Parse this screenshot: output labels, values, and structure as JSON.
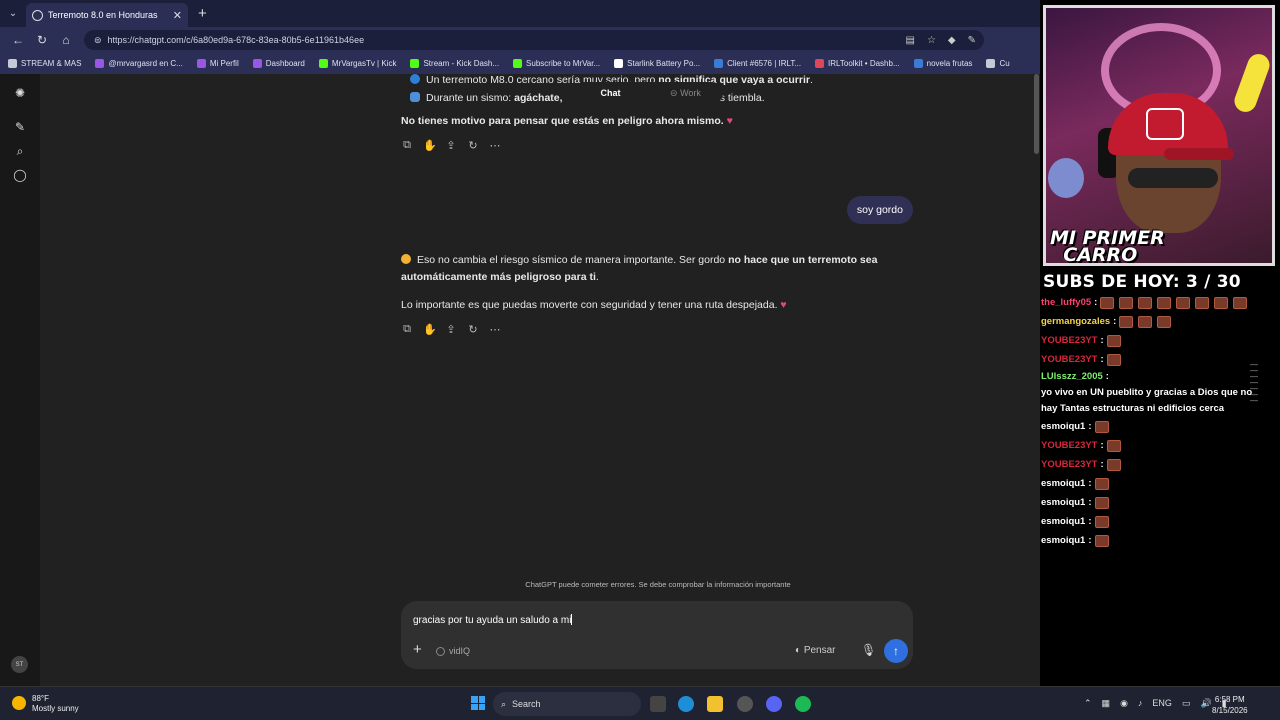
{
  "browser": {
    "tab_title": "Terremoto 8.0 en Honduras",
    "url": "https://chatgpt.com/c/6a80ed9a-678c-83ea-80b5-6e11961b46ee",
    "bookmarks": [
      {
        "label": "STREAM & MAS",
        "color": "#c7c9d6"
      },
      {
        "label": "@mrvargasrd en C...",
        "color": "#9a57e6"
      },
      {
        "label": "Mi Perfil",
        "color": "#9a57e6"
      },
      {
        "label": "Dashboard",
        "color": "#9a57e6"
      },
      {
        "label": "MrVargasTv | Kick",
        "color": "#53fc18"
      },
      {
        "label": "Stream - Kick Dash...",
        "color": "#53fc18"
      },
      {
        "label": "Subscribe to MrVar...",
        "color": "#53fc18"
      },
      {
        "label": "Starlink Battery Po...",
        "color": "#ffffff"
      },
      {
        "label": "Client #6576 | IRLT...",
        "color": "#3a7bd5"
      },
      {
        "label": "IRLToolkit • Dashb...",
        "color": "#e0455a"
      },
      {
        "label": "novela frutas",
        "color": "#3a7bd5"
      },
      {
        "label": "Cu",
        "color": "#c7c9d6"
      }
    ]
  },
  "chat": {
    "toggle": {
      "chat": "Chat",
      "work": "Work"
    },
    "bullets": [
      {
        "pre": "Un terremoto M8.0 cercano sería muy serio, pero ",
        "bold": "no significa que vaya a ocurrir",
        "post": "."
      },
      {
        "pre": "Durante un sismo: ",
        "bold": "agáchate,",
        "post": " cubriendo mientras tiembla."
      }
    ],
    "bullet2_tail": "riendo mientras tiembla.",
    "reassure": "No tienes motivo para pensar que estás en peligro ahora mismo.",
    "user_message": "soy gordo",
    "reply_pre": "Eso no cambia el riesgo sísmico de manera importante. Ser gordo ",
    "reply_bold_1": "no hace que un terremoto sea",
    "reply_bold_2": "automáticamente más peligroso para ti",
    "reply_end": ".",
    "reply_2": "Lo importante es que puedas moverte con seguridad y tener una ruta despejada.",
    "disclaimer": "ChatGPT puede cometer errores. Se debe comprobar la información importante",
    "composer_text": "gracias por tu ayuda un saludo a mi",
    "vidiq": "vidIQ",
    "think": "Pensar",
    "avatar": "ST"
  },
  "taskbar": {
    "temp": "88°F",
    "weather": "Mostly sunny",
    "search": "Search",
    "lang": "ENG",
    "time": "6:58 PM",
    "date": "8/15/2026"
  },
  "stream": {
    "cam_label_1": "MI PRIMER",
    "cam_label_2": "CARRO",
    "subs": "SUBS DE HOY: 3 / 30",
    "chat": [
      {
        "user": "the_luffy05",
        "color": "#ff3f6d",
        "emotes": 8,
        "text": ""
      },
      {
        "user": "germangozales",
        "color": "#f5d547",
        "emotes": 3,
        "text": ""
      },
      {
        "user": "YOUBE23YT",
        "color": "#d8263a",
        "emotes": 1,
        "text": ""
      },
      {
        "user": "YOUBE23YT",
        "color": "#d8263a",
        "emotes": 1,
        "text": ""
      },
      {
        "user": "LUIsszz_2005",
        "color": "#7cf06a",
        "emotes": 0,
        "text": "yo vivo en UN pueblito y gracias a Dios que no hay Tantas estructuras ni edificios cerca"
      },
      {
        "user": "esmoiqu1",
        "color": "#ffffff",
        "emotes": 1,
        "text": ""
      },
      {
        "user": "YOUBE23YT",
        "color": "#d8263a",
        "emotes": 1,
        "text": ""
      },
      {
        "user": "YOUBE23YT",
        "color": "#d8263a",
        "emotes": 1,
        "text": ""
      },
      {
        "user": "esmoiqu1",
        "color": "#ffffff",
        "emotes": 1,
        "text": ""
      },
      {
        "user": "esmoiqu1",
        "color": "#ffffff",
        "emotes": 1,
        "text": ""
      },
      {
        "user": "esmoiqu1",
        "color": "#ffffff",
        "emotes": 1,
        "text": ""
      },
      {
        "user": "esmoiqu1",
        "color": "#ffffff",
        "emotes": 1,
        "text": ""
      }
    ]
  }
}
